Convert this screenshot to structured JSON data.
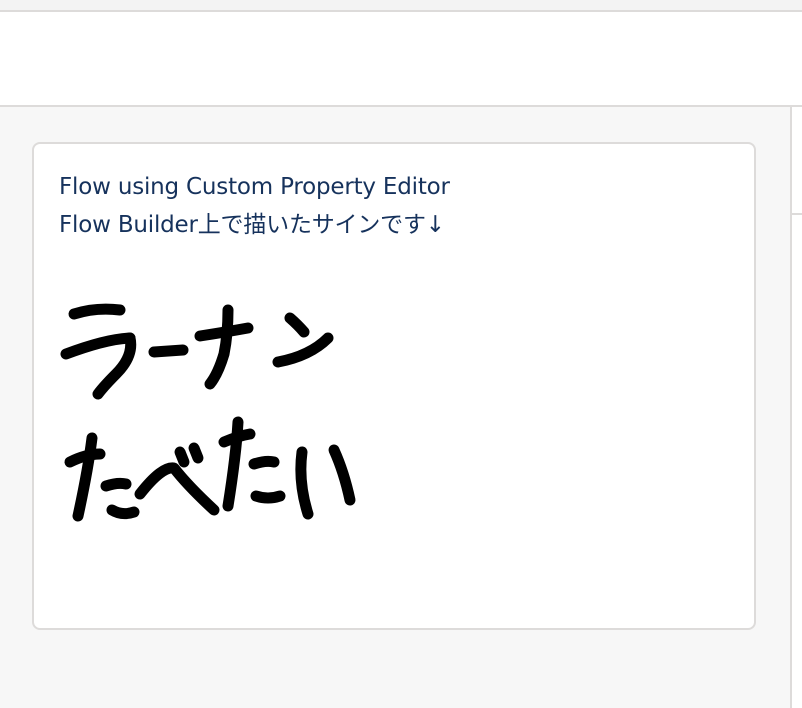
{
  "flow_screen": {
    "display_text": {
      "line1": "Flow using Custom Property Editor",
      "line2": "Flow Builder上で描いたサインです↓"
    },
    "signature": {
      "handwritten_text": "ラーナンたべたい"
    }
  },
  "colors": {
    "text": "#16325c",
    "card_border": "#dddbda",
    "page_background": "#f7f7f7",
    "ink": "#000000"
  }
}
